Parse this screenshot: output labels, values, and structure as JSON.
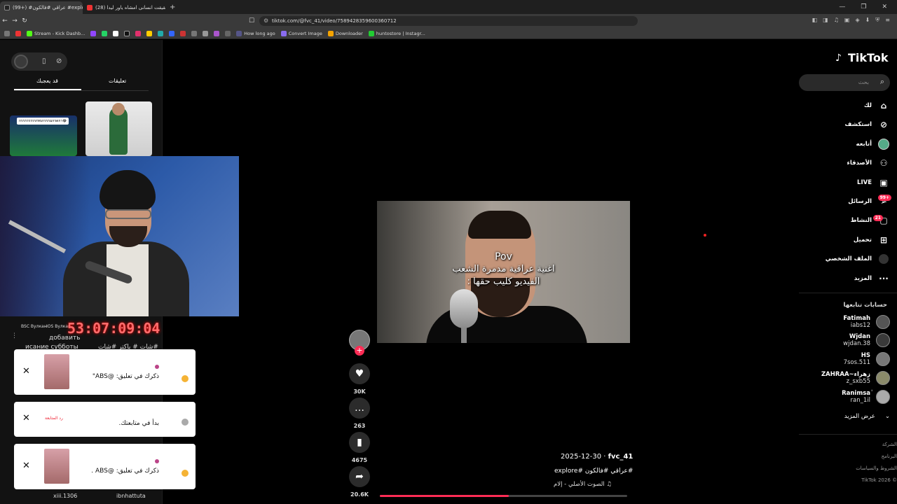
{
  "browser": {
    "tabs": [
      {
        "title": "(99+) #عراقي #فالكون #explore"
      },
      {
        "title": "(28) حقيقت انسانی امشاه یاور لیدا"
      }
    ],
    "url": "tiktok.com/@fvc_41/video/7589428359600360712",
    "bookmarks": [
      "Stream - Kick Dashb...",
      "How long ago",
      "Convert Image",
      "Downloader",
      "huntostore | Instagr..."
    ]
  },
  "left_panel": {
    "tabs": [
      "تعليقات",
      "قد يعجبك"
    ],
    "thumb_caption": "กรรรรรรรรrทบกรรรมกรดกา😂",
    "timer": "53:07:09:04",
    "tiny_labels": [
      "BSC Вулкан",
      "IOS Вулкан",
      "добавить",
      "исание субботы",
      "#شات # باكتر #شات"
    ],
    "notifications": [
      {
        "text": "ذكرك في تعليق: @ABS\"",
        "kind": "mention"
      },
      {
        "text": "بدأ في متابعتك.",
        "extra": "رد المتابعة",
        "kind": "follow"
      },
      {
        "text": "ذكرك في تعليق: @ABS .",
        "kind": "mention"
      }
    ],
    "bottom_users": [
      "xiii.1306",
      "ibnhattuta"
    ]
  },
  "video": {
    "overlay_pov": "Pov",
    "overlay_line1": "اغنية عراقية مدمرة الشعب",
    "overlay_line2": "الفيديو كليب حقها :",
    "author": "fvc_41",
    "date": "2025-12-30",
    "hashtags": "#عراقي #فالكون #explore",
    "music": "الصوت الأصلي - إلام",
    "progress": 0.52
  },
  "actions": {
    "likes": "30K",
    "comments": "263",
    "saves": "4675",
    "shares": "20.6K"
  },
  "sidebar": {
    "logo": "TikTok",
    "search_placeholder": "بحث",
    "nav": [
      {
        "label": "لك",
        "icon": "home-icon"
      },
      {
        "label": "استكشف",
        "icon": "compass-icon"
      },
      {
        "label": "أتابعه",
        "icon": "avatar-icon"
      },
      {
        "label": "الأصدقاء",
        "icon": "friends-icon"
      },
      {
        "label": "LIVE",
        "icon": "live-icon"
      },
      {
        "label": "الرسائل",
        "icon": "messages-icon",
        "badge": "99+"
      },
      {
        "label": "النشاط",
        "icon": "activity-icon",
        "badge": "21"
      },
      {
        "label": "تحميل",
        "icon": "upload-icon"
      },
      {
        "label": "الملف الشخصي",
        "icon": "profile-icon"
      },
      {
        "label": "المزيد",
        "icon": "more-icon"
      }
    ],
    "following_title": "حسابات تتابعها",
    "following": [
      {
        "name": "Fatimah",
        "handle": "iabs12"
      },
      {
        "name": "Wjdan",
        "handle": "wjdan.38"
      },
      {
        "name": "HS",
        "handle": "7sos.511"
      },
      {
        "name": "ZAHRAA~زهراء",
        "handle": "z_sxb55"
      },
      {
        "name": "Ranimsaٰ",
        "handle": "ran_1il"
      }
    ],
    "show_more": "عرض المزيد",
    "footer": [
      "الشركة",
      "البرنامج",
      "الشروط والسياسات",
      "TikTok 2026 ©"
    ]
  }
}
